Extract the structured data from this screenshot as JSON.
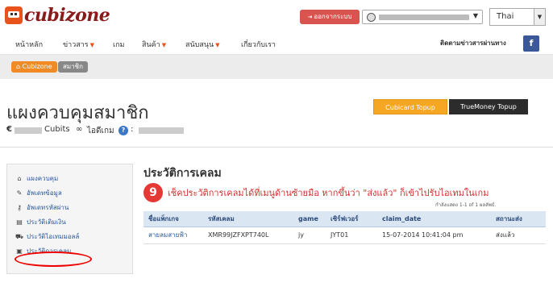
{
  "header": {
    "logo_text": "cubizone",
    "logout_label": "ออกจากระบบ",
    "language": "Thai"
  },
  "nav": {
    "items": [
      {
        "label": "หน้าหลัก",
        "has_dropdown": false
      },
      {
        "label": "ข่าวสาร",
        "has_dropdown": true
      },
      {
        "label": "เกม",
        "has_dropdown": false
      },
      {
        "label": "สินค้า",
        "has_dropdown": true
      },
      {
        "label": "สนับสนุน",
        "has_dropdown": true
      },
      {
        "label": "เกี่ยวกับเรา",
        "has_dropdown": false
      }
    ],
    "follow_label": "ติดตามข่าวสารผ่านทาง",
    "facebook_label": "f"
  },
  "breadcrumb": {
    "items": [
      "Cubizone",
      "สมาชิก"
    ]
  },
  "page": {
    "title": "แผงควบคุมสมาชิก",
    "currency_symbol": "€",
    "cubits_label": "Cubits",
    "game_id_label": "ไอดีเกม",
    "help_label": "?",
    "colon": ":",
    "cubicard_topup": "Cubicard Topup",
    "truemoney_topup": "TrueMoney Topup"
  },
  "sidebar": {
    "items": [
      {
        "label": "แผงควบคุม",
        "icon": "home-icon"
      },
      {
        "label": "อัพเดทข้อมูล",
        "icon": "pencil-icon"
      },
      {
        "label": "อัพเดทรหัสผ่าน",
        "icon": "key-icon"
      },
      {
        "label": "ประวัติเติมเงิน",
        "icon": "document-icon"
      },
      {
        "label": "ประวัติไอเทมมอลล์",
        "icon": "cart-icon"
      },
      {
        "label": "ประวัติการเคลม",
        "icon": "gift-icon"
      }
    ]
  },
  "main": {
    "section_title": "ประวัติการเคลม",
    "step_number": "9",
    "note": "เช็คประวัติการเคลมได้ที่เมนูด้านซ้ายมือ หากขึ้นว่า \"ส่งแล้ว\" ก็เข้าไปรับไอเทมในเกม",
    "showing_text": "กำลังแสดง 1-1 of 1 ผลลัพธ์.",
    "table": {
      "columns": [
        "ชื่อแพ็กเกจ",
        "รหัสเคลม",
        "game",
        "เซิร์ฟเวอร์",
        "claim_date",
        "สถานะส่ง"
      ],
      "rows": [
        [
          "สายลมสายฟ้า",
          "XMR99JZFXPT740L",
          "jy",
          "JYT01",
          "15-07-2014 10:41:04 pm",
          "ส่งแล้ว"
        ]
      ]
    }
  },
  "colors": {
    "accent_orange": "#f5a623",
    "logout_red": "#d9534f",
    "annotation_red": "#e53935",
    "link_blue": "#2a5a9a",
    "facebook_blue": "#3b5998"
  }
}
